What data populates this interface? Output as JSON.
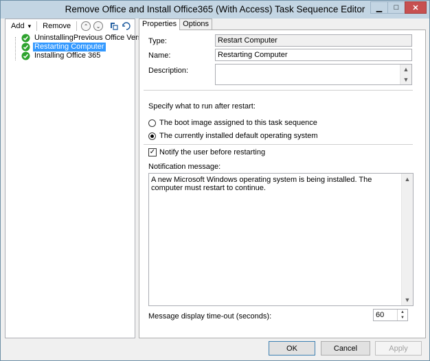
{
  "window": {
    "title": "Remove Office and Install Office365 (With Access) Task Sequence Editor",
    "min_glyph": "▁",
    "max_glyph": "□",
    "close_glyph": "✕"
  },
  "toolbar": {
    "add_label": "Add",
    "add_caret": "▾",
    "remove_label": "Remove",
    "move_up_glyph": "⌃",
    "move_down_glyph": "⌄"
  },
  "tree": {
    "items": [
      {
        "label": "UninstallingPrevious Office Versions.",
        "selected": false
      },
      {
        "label": "Restarting Computer",
        "selected": true
      },
      {
        "label": "Installing Office 365",
        "selected": false
      }
    ]
  },
  "tabs": {
    "properties": "Properties",
    "options": "Options"
  },
  "form": {
    "type_label": "Type:",
    "type_value": "Restart Computer",
    "name_label": "Name:",
    "name_value": "Restarting Computer",
    "description_label": "Description:",
    "description_value": "",
    "specify_label": "Specify what to run after restart:",
    "radio_boot": "The boot image assigned to this task sequence",
    "radio_os": "The currently installed default operating system",
    "radio_selected": "os",
    "notify_label": "Notify the user before restarting",
    "notify_checked": true,
    "notification_label": "Notification message:",
    "notification_text": "A new Microsoft Windows operating system is being installed. The computer must restart to continue.",
    "timeout_label": "Message display time-out (seconds):",
    "timeout_value": "60"
  },
  "footer": {
    "ok": "OK",
    "cancel": "Cancel",
    "apply": "Apply"
  },
  "colors": {
    "titlebar": "#c3d5e3",
    "selection": "#3399ff",
    "check_green": "#2ea32e",
    "close_red": "#c75050"
  }
}
